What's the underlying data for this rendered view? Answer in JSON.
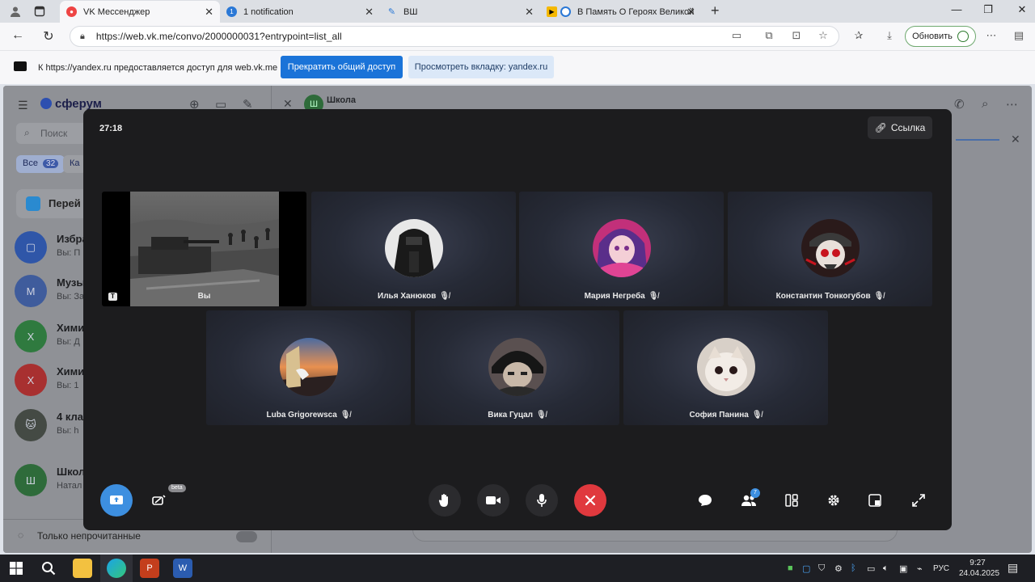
{
  "browser": {
    "tabs": [
      {
        "label": "VK Мессенджер",
        "active": true
      },
      {
        "label": "1 notification",
        "active": false
      },
      {
        "label": "ВШ",
        "active": false
      },
      {
        "label": "В Память О Героях Великой",
        "active": false
      }
    ],
    "url": "https://web.vk.me/convo/2000000031?entrypoint=list_all",
    "update_label": "Обновить"
  },
  "share_banner": {
    "text": "К https://yandex.ru предоставляется доступ для web.vk.me",
    "stop_label": "Прекратить общий доступ",
    "view_label": "Просмотреть вкладку: yandex.ru"
  },
  "vk": {
    "logo": "сферум",
    "search_placeholder": "Поиск",
    "filter_all": "Все",
    "filter_all_count": "32",
    "filter_other": "Ка",
    "goto_label": "Перей",
    "chats": [
      {
        "letter": "",
        "name": "Избра",
        "preview": "Вы: П",
        "color": "#2f56a8"
      },
      {
        "letter": "М",
        "name": "Музы",
        "preview": "Вы: За",
        "color": "#3f5c9c"
      },
      {
        "letter": "Х",
        "name": "Хими",
        "preview": "Вы: Д",
        "color": "#2f7a3f"
      },
      {
        "letter": "Х",
        "name": "Хими",
        "preview": "Вы: 1",
        "color": "#a83030"
      },
      {
        "letter": "",
        "name": "4 кла",
        "preview": "Вы: h",
        "color": "#444a44"
      },
      {
        "letter": "Ш",
        "name": "Школ",
        "preview": "Натал",
        "color": "#2e6b3a"
      }
    ],
    "unread_only": "Только непрочитанные",
    "conversation_title": "Школа",
    "conversation_avatar": "Ш"
  },
  "call": {
    "timer": "27:18",
    "link_label": "Ссылка",
    "participants": [
      {
        "name": "Вы",
        "self": true
      },
      {
        "name": "Илья Ханюков",
        "muted": true
      },
      {
        "name": "Мария Негреба",
        "muted": true
      },
      {
        "name": "Константин Тонкогубов",
        "muted": true
      },
      {
        "name": "Luba Grigorewsca",
        "muted": true
      },
      {
        "name": "Вика Гуцал",
        "muted": true
      },
      {
        "name": "София Панина",
        "muted": true
      }
    ],
    "self_badge": "T",
    "beta_label": "beta",
    "participants_count": "7"
  },
  "taskbar": {
    "language": "РУС",
    "time": "9:27",
    "date": "24.04.2025"
  },
  "colors": {
    "primary_blue": "#1a73d8",
    "call_bg": "#1c1c1e",
    "end_call_red": "#e0393e",
    "screen_share_blue": "#3d8fe0"
  }
}
